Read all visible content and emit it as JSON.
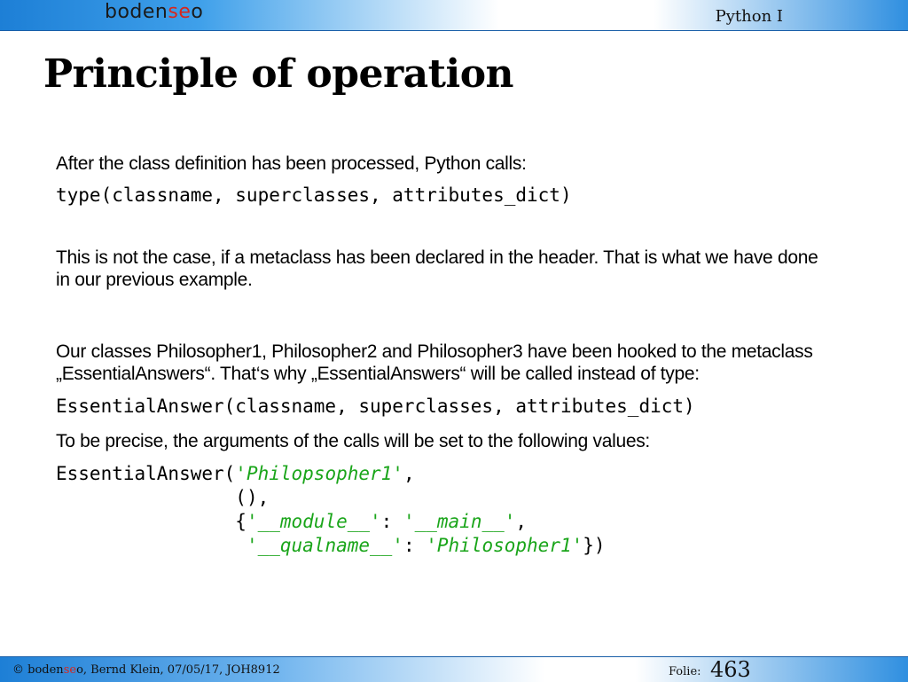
{
  "header": {
    "logo": {
      "part1": "boden",
      "part2": "se",
      "part3": "o"
    },
    "course": "Python I"
  },
  "title": "Principle of operation",
  "content": {
    "p1": "After the class definition has been processed, Python calls:",
    "code1": "type(classname, superclasses, attributes_dict)",
    "p2": "This is not the case, if a metaclass has been declared in the header. That is what we have done in our previous example.",
    "p3": "Our classes Philosopher1, Philosopher2 and Philosopher3 have been hooked to the metaclass „EssentialAnswers“. That‘s why „EssentialAnswers“ will be called instead of type:",
    "code2": "EssentialAnswer(classname, superclasses, attributes_dict)",
    "p4": "To be precise, the arguments of the calls will be set to the following values:",
    "code3": {
      "l1_prefix": "EssentialAnswer(",
      "l1_str": "'Philopsopher1'",
      "l1_suffix": ",",
      "l2_indent": "                ",
      "l2": "(),",
      "l3_indent": "                ",
      "l3_open": "{",
      "l3_str1": "'__module__'",
      "l3_colon": ": ",
      "l3_str2": "'__main__'",
      "l3_comma": ",",
      "l4_indent": "                 ",
      "l4_str1": "'__qualname__'",
      "l4_colon": ": ",
      "l4_str2": "'Philosopher1'",
      "l4_close": "})"
    }
  },
  "footer": {
    "copyright": "© ",
    "logo": {
      "part1": "boden",
      "part2": "se",
      "part3": "o"
    },
    "info": ", Bernd Klein, 07/05/17, JOH8912",
    "folie_label": "Folie:",
    "folie_num": "463"
  }
}
